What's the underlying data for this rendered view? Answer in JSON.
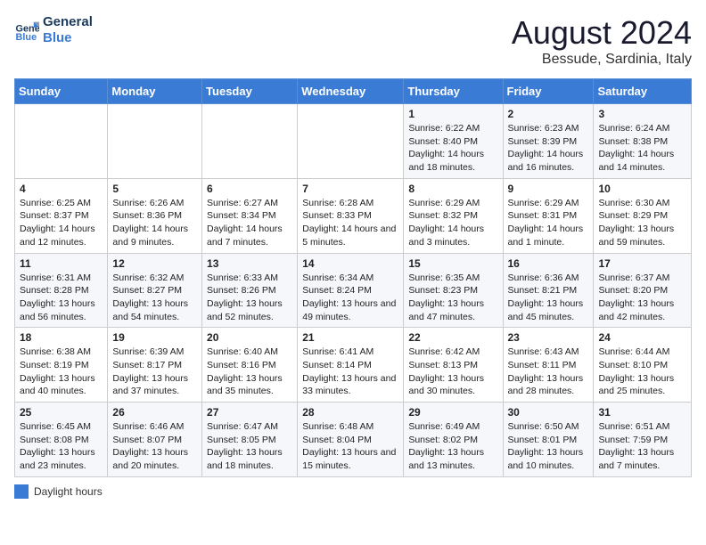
{
  "logo": {
    "line1": "General",
    "line2": "Blue"
  },
  "title": "August 2024",
  "location": "Bessude, Sardinia, Italy",
  "days_of_week": [
    "Sunday",
    "Monday",
    "Tuesday",
    "Wednesday",
    "Thursday",
    "Friday",
    "Saturday"
  ],
  "legend_label": "Daylight hours",
  "weeks": [
    [
      {
        "day": "",
        "info": ""
      },
      {
        "day": "",
        "info": ""
      },
      {
        "day": "",
        "info": ""
      },
      {
        "day": "",
        "info": ""
      },
      {
        "day": "1",
        "info": "Sunrise: 6:22 AM\nSunset: 8:40 PM\nDaylight: 14 hours and 18 minutes."
      },
      {
        "day": "2",
        "info": "Sunrise: 6:23 AM\nSunset: 8:39 PM\nDaylight: 14 hours and 16 minutes."
      },
      {
        "day": "3",
        "info": "Sunrise: 6:24 AM\nSunset: 8:38 PM\nDaylight: 14 hours and 14 minutes."
      }
    ],
    [
      {
        "day": "4",
        "info": "Sunrise: 6:25 AM\nSunset: 8:37 PM\nDaylight: 14 hours and 12 minutes."
      },
      {
        "day": "5",
        "info": "Sunrise: 6:26 AM\nSunset: 8:36 PM\nDaylight: 14 hours and 9 minutes."
      },
      {
        "day": "6",
        "info": "Sunrise: 6:27 AM\nSunset: 8:34 PM\nDaylight: 14 hours and 7 minutes."
      },
      {
        "day": "7",
        "info": "Sunrise: 6:28 AM\nSunset: 8:33 PM\nDaylight: 14 hours and 5 minutes."
      },
      {
        "day": "8",
        "info": "Sunrise: 6:29 AM\nSunset: 8:32 PM\nDaylight: 14 hours and 3 minutes."
      },
      {
        "day": "9",
        "info": "Sunrise: 6:29 AM\nSunset: 8:31 PM\nDaylight: 14 hours and 1 minute."
      },
      {
        "day": "10",
        "info": "Sunrise: 6:30 AM\nSunset: 8:29 PM\nDaylight: 13 hours and 59 minutes."
      }
    ],
    [
      {
        "day": "11",
        "info": "Sunrise: 6:31 AM\nSunset: 8:28 PM\nDaylight: 13 hours and 56 minutes."
      },
      {
        "day": "12",
        "info": "Sunrise: 6:32 AM\nSunset: 8:27 PM\nDaylight: 13 hours and 54 minutes."
      },
      {
        "day": "13",
        "info": "Sunrise: 6:33 AM\nSunset: 8:26 PM\nDaylight: 13 hours and 52 minutes."
      },
      {
        "day": "14",
        "info": "Sunrise: 6:34 AM\nSunset: 8:24 PM\nDaylight: 13 hours and 49 minutes."
      },
      {
        "day": "15",
        "info": "Sunrise: 6:35 AM\nSunset: 8:23 PM\nDaylight: 13 hours and 47 minutes."
      },
      {
        "day": "16",
        "info": "Sunrise: 6:36 AM\nSunset: 8:21 PM\nDaylight: 13 hours and 45 minutes."
      },
      {
        "day": "17",
        "info": "Sunrise: 6:37 AM\nSunset: 8:20 PM\nDaylight: 13 hours and 42 minutes."
      }
    ],
    [
      {
        "day": "18",
        "info": "Sunrise: 6:38 AM\nSunset: 8:19 PM\nDaylight: 13 hours and 40 minutes."
      },
      {
        "day": "19",
        "info": "Sunrise: 6:39 AM\nSunset: 8:17 PM\nDaylight: 13 hours and 37 minutes."
      },
      {
        "day": "20",
        "info": "Sunrise: 6:40 AM\nSunset: 8:16 PM\nDaylight: 13 hours and 35 minutes."
      },
      {
        "day": "21",
        "info": "Sunrise: 6:41 AM\nSunset: 8:14 PM\nDaylight: 13 hours and 33 minutes."
      },
      {
        "day": "22",
        "info": "Sunrise: 6:42 AM\nSunset: 8:13 PM\nDaylight: 13 hours and 30 minutes."
      },
      {
        "day": "23",
        "info": "Sunrise: 6:43 AM\nSunset: 8:11 PM\nDaylight: 13 hours and 28 minutes."
      },
      {
        "day": "24",
        "info": "Sunrise: 6:44 AM\nSunset: 8:10 PM\nDaylight: 13 hours and 25 minutes."
      }
    ],
    [
      {
        "day": "25",
        "info": "Sunrise: 6:45 AM\nSunset: 8:08 PM\nDaylight: 13 hours and 23 minutes."
      },
      {
        "day": "26",
        "info": "Sunrise: 6:46 AM\nSunset: 8:07 PM\nDaylight: 13 hours and 20 minutes."
      },
      {
        "day": "27",
        "info": "Sunrise: 6:47 AM\nSunset: 8:05 PM\nDaylight: 13 hours and 18 minutes."
      },
      {
        "day": "28",
        "info": "Sunrise: 6:48 AM\nSunset: 8:04 PM\nDaylight: 13 hours and 15 minutes."
      },
      {
        "day": "29",
        "info": "Sunrise: 6:49 AM\nSunset: 8:02 PM\nDaylight: 13 hours and 13 minutes."
      },
      {
        "day": "30",
        "info": "Sunrise: 6:50 AM\nSunset: 8:01 PM\nDaylight: 13 hours and 10 minutes."
      },
      {
        "day": "31",
        "info": "Sunrise: 6:51 AM\nSunset: 7:59 PM\nDaylight: 13 hours and 7 minutes."
      }
    ]
  ]
}
